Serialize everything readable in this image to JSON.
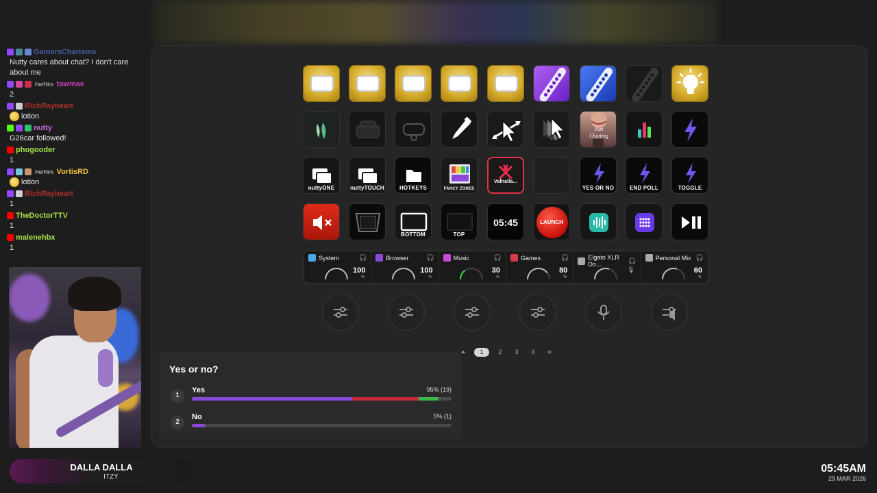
{
  "chat": [
    {
      "user": "GamersCharisma",
      "color": "#4a5ea8",
      "badges": [
        "#9146ff",
        "#4a8c9c",
        "#6a8ad0"
      ],
      "pronoun": "",
      "text": "Nutty cares about chat? I don't care about me"
    },
    {
      "user": "tawmae",
      "color": "#c23fb6",
      "badges": [
        "#9146ff",
        "#d44a9a",
        "#c82f4a"
      ],
      "pronoun": "He/Him",
      "text": "2"
    },
    {
      "user": "RichRayheart",
      "color": "#b0302a",
      "badges": [
        "#9146ff",
        "#cfcfcf"
      ],
      "pronoun": "",
      "text": "lotion",
      "emote": true
    },
    {
      "user": "nutty",
      "color": "#c46bd8",
      "badges": [
        "#53fc18",
        "#9146ff",
        "#2ec26a"
      ],
      "pronoun": "",
      "text": "G26car followed!"
    },
    {
      "user": "phogooder",
      "color": "#a6e24a",
      "badges": [
        "#ff0000"
      ],
      "pronoun": "",
      "text": "1"
    },
    {
      "user": "VortisRD",
      "color": "#f0c33a",
      "badges": [
        "#9146ff",
        "#76c8d8",
        "#c89a6a"
      ],
      "pronoun": "He/Him",
      "text": "lotion",
      "emote": true
    },
    {
      "user": "RichRayheart",
      "color": "#b0302a",
      "badges": [
        "#9146ff",
        "#cfcfcf"
      ],
      "pronoun": "",
      "text": "1"
    },
    {
      "user": "TheDoctorTTV",
      "color": "#a6e24a",
      "badges": [
        "#ff0000"
      ],
      "pronoun": "",
      "text": "1"
    },
    {
      "user": "malenehbx",
      "color": "#a6e24a",
      "badges": [
        "#ff0000"
      ],
      "pronoun": "",
      "text": "1"
    }
  ],
  "now_playing": {
    "title": "DALLA DALLA",
    "artist": "ITZY"
  },
  "clock": {
    "time": "05:45AM",
    "date": "29 MAR 2026"
  },
  "keys": {
    "row1": [
      {
        "name": "gold-key-1",
        "icon": "blank-rounded-rect-icon"
      },
      {
        "name": "gold-key-2",
        "icon": "blank-rounded-rect-icon"
      },
      {
        "name": "gold-key-3",
        "icon": "blank-rounded-rect-icon"
      },
      {
        "name": "gold-key-4",
        "icon": "blank-rounded-rect-icon"
      },
      {
        "name": "gold-key-5",
        "icon": "blank-rounded-rect-icon"
      },
      {
        "name": "stream-deck-purple-key",
        "icon": "stream-deck-purple-icon"
      },
      {
        "name": "stream-deck-blue-key",
        "icon": "stream-deck-blue-icon"
      },
      {
        "name": "stream-deck-dark-key",
        "icon": "stream-deck-dark-icon"
      },
      {
        "name": "lightbulb-key",
        "icon": "lightbulb-icon"
      }
    ],
    "row2_icons": [
      "leaf-logo-icon",
      "vr-headset-icon",
      "vr-headset-outline-icon",
      "eyedropper-icon",
      "resize-arrows-cursor-icon",
      "cursor-trail-icon",
      "just-chatting-thumbnail-icon",
      "bar-chart-icon",
      "lightning-icon"
    ],
    "row3": [
      {
        "label": "nuttyONE",
        "icon": "windows-stack-icon"
      },
      {
        "label": "nuttyTOUCH",
        "icon": "windows-stack-icon"
      },
      {
        "label": "HOTKEYS",
        "icon": "folder-icon"
      },
      {
        "label": "FANCY ZONES",
        "icon": "fancy-zones-icon"
      },
      {
        "label": "Valhalla...",
        "icon": "valhalla-icon"
      },
      {
        "label": "",
        "icon": "empty-key-icon"
      },
      {
        "label": "YES OR NO",
        "icon": "lightning-icon"
      },
      {
        "label": "END POLL",
        "icon": "lightning-icon"
      },
      {
        "label": "TOGGLE",
        "icon": "lightning-icon"
      }
    ],
    "row4": [
      {
        "label": "",
        "icon": "mute-speaker-icon"
      },
      {
        "label": "",
        "icon": "perspective-screen-icon"
      },
      {
        "label": "BOTTOM",
        "icon": "monitor-icon"
      },
      {
        "label": "TOP",
        "icon": "monitor-dark-icon"
      },
      {
        "label": "05:45",
        "icon": "clock-text"
      },
      {
        "label": "LAUNCH",
        "icon": "red-launch-button-icon"
      },
      {
        "label": "",
        "icon": "audio-wave-app-icon"
      },
      {
        "label": "",
        "icon": "grid-app-icon"
      },
      {
        "label": "",
        "icon": "play-pause-icon"
      }
    ]
  },
  "dials": [
    {
      "name": "System",
      "value": "100",
      "pct": "%",
      "color": "#4aa8e8",
      "level": 1.0
    },
    {
      "name": "Browser",
      "value": "100",
      "pct": "%",
      "color": "#8a4ad8",
      "level": 1.0
    },
    {
      "name": "Music",
      "value": "30",
      "pct": "%",
      "color": "#c84ad0",
      "level": 0.3
    },
    {
      "name": "Games",
      "value": "80",
      "pct": "%",
      "color": "#d83a4a",
      "level": 0.8
    },
    {
      "name": "Elgato XLR Do...",
      "value": "",
      "pct": "",
      "color": "#aaaaaa",
      "level": 0.6
    },
    {
      "name": "Personal Mix",
      "value": "60",
      "pct": "%",
      "color": "#aaaaaa",
      "level": 0.6
    }
  ],
  "round_buttons": [
    "sliders-icon",
    "sliders-icon",
    "sliders-icon",
    "sliders-icon",
    "microphone-icon",
    "speaker-sliders-icon"
  ],
  "pager": {
    "pages": [
      "1",
      "2",
      "3",
      "4"
    ],
    "active": "1",
    "add": "+"
  },
  "poll": {
    "title": "Yes or no?",
    "options": [
      {
        "num": "1",
        "label": "Yes",
        "result": "95% (19)",
        "fraction": 0.95
      },
      {
        "num": "2",
        "label": "No",
        "result": "5% (1)",
        "fraction": 0.05
      }
    ]
  }
}
